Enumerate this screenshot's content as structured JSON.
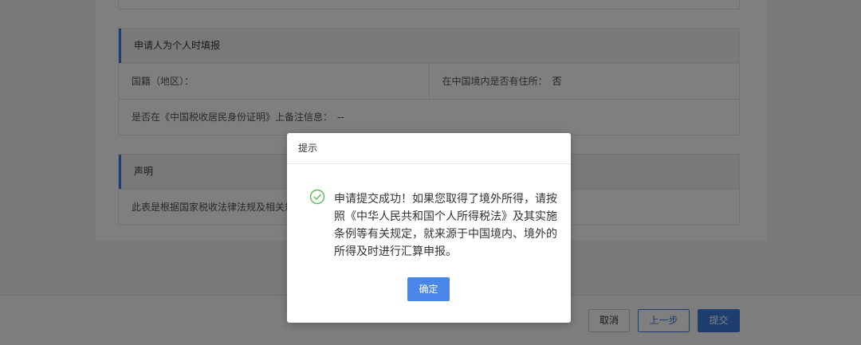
{
  "applicant_section": {
    "title": "申请人为个人时填报",
    "nationality_label": "国籍（地区）：",
    "nationality_value": "",
    "residence_label": "在中国境内是否有住所：",
    "residence_value": "否",
    "certificate_label": "是否在《中国税收居民身份证明》上备注信息：",
    "certificate_value": "--"
  },
  "declaration_section": {
    "title": "声明",
    "text": "此表是根据国家税收法律法规及相关规"
  },
  "footer": {
    "cancel_label": "取消",
    "prev_label": "上一步",
    "submit_label": "提交"
  },
  "modal": {
    "title": "提示",
    "icon": "check-circle-icon",
    "message": "申请提交成功！如果您取得了境外所得，请按照《中华人民共和国个人所得税法》及其实施条例等有关规定，就来源于中国境内、境外的所得及时进行汇算申报。",
    "confirm_label": "确定",
    "accent_color": "#4a86e8",
    "success_color": "#5cb85c"
  }
}
